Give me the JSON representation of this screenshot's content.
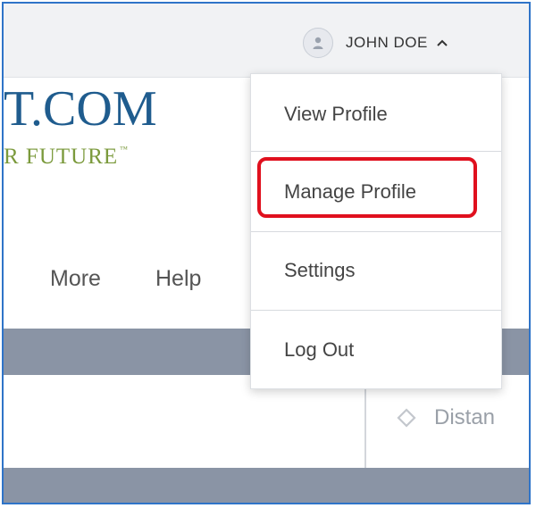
{
  "header": {
    "user": {
      "name": "JOHN DOE",
      "avatar_icon": "user-icon",
      "caret_icon": "chevron-up-icon"
    }
  },
  "logo": {
    "line1": "T.COM",
    "line2": "R FUTURE",
    "trademark": "™"
  },
  "nav": {
    "items": [
      "More",
      "Help"
    ]
  },
  "content": {
    "distance_label": "Distan",
    "distance_icon": "diamond-icon"
  },
  "user_dropdown": {
    "items": [
      "View Profile",
      "Manage Profile",
      "Settings",
      "Log Out"
    ],
    "highlighted": "Manage Profile",
    "highlight_color": "#e0101e"
  },
  "colors": {
    "frame": "#2f74c8",
    "band": "#8a94a5",
    "logo_blue": "#1f5c8e",
    "logo_green": "#7b9a3c"
  }
}
